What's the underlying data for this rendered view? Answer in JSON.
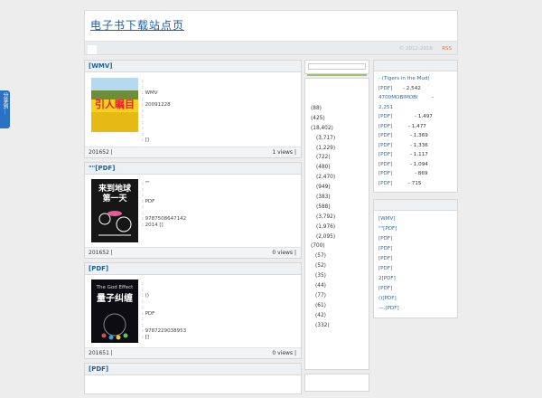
{
  "share": {
    "label": "分享到"
  },
  "header": {
    "title": "电子书下载站点页",
    "copyright": "© 2012-2016",
    "rss": "RSS"
  },
  "posts": [
    {
      "title": "[WMV]",
      "meta": [
        ":",
        ":",
        ": WMV",
        ":",
        ": 20091228",
        ":",
        ":",
        ":",
        ":",
        ":",
        ":          []"
      ],
      "date": "201652 |",
      "views": "1 views |"
    },
    {
      "title": "\"\"[PDF]",
      "meta": [
        ": \"\"",
        ":",
        ":",
        ": PDF",
        ":",
        ":",
        ": 9787508647142",
        ": 2014  []"
      ],
      "date": "201652 |",
      "views": "0 views |"
    },
    {
      "title": "[PDF]",
      "meta": [
        ":",
        ":",
        ": ()",
        ":",
        ":",
        ": PDF",
        ":",
        ":",
        ": 9787229038953",
        ":    []"
      ],
      "date": "201651 |",
      "views": "0 views |"
    },
    {
      "title": "[PDF]"
    }
  ],
  "thumbs": {
    "t1_text": "引人瞩目",
    "t2_l1": "来到地球",
    "t2_l2": "第一天",
    "t3_top": "The God Effect",
    "t3_title": "量子纠缠"
  },
  "categories": [
    {
      "label": "(88)",
      "lvl": 0
    },
    {
      "label": "(425)",
      "lvl": 0
    },
    {
      "label": "(18,402)",
      "lvl": 0
    },
    {
      "label": "(3,717)",
      "lvl": 1
    },
    {
      "label": "(1,229)",
      "lvl": 1
    },
    {
      "label": "(722)",
      "lvl": 1
    },
    {
      "label": "(480)",
      "lvl": 1
    },
    {
      "label": "(2,470)",
      "lvl": 1
    },
    {
      "label": "(949)",
      "lvl": 1
    },
    {
      "label": "(383)",
      "lvl": 1
    },
    {
      "label": "(588)",
      "lvl": 1
    },
    {
      "label": "(3,792)",
      "lvl": 1
    },
    {
      "label": "(1,976)",
      "lvl": 1
    },
    {
      "label": "(2,095)",
      "lvl": 1
    },
    {
      "label": "(700)",
      "lvl": 0
    },
    {
      "label": "(57)",
      "lvl": 2
    },
    {
      "label": "(52)",
      "lvl": 2
    },
    {
      "label": "(35)",
      "lvl": 2
    },
    {
      "label": "(44)",
      "lvl": 2
    },
    {
      "label": "(77)",
      "lvl": 2
    },
    {
      "label": "(61)",
      "lvl": 2
    },
    {
      "label": "(42)",
      "lvl": 2
    },
    {
      "label": "(332)",
      "lvl": 2
    }
  ],
  "popular": [
    {
      "label": "- (Tigers in the Mud)",
      "value": ""
    },
    {
      "label": "[PDF]",
      "value": "- 2,542"
    },
    {
      "label": "4700MOBIMOBI",
      "value": "-"
    },
    {
      "label": "2,251",
      "value": ""
    },
    {
      "label": " [PDF]",
      "value": "- 1,497"
    },
    {
      "label": "[PDF]",
      "value": "- 1,477"
    },
    {
      "label": "[PDF]",
      "value": "- 1,369"
    },
    {
      "label": "[PDF]",
      "value": "- 1,336"
    },
    {
      "label": "[PDF]",
      "value": "- 1,117"
    },
    {
      "label": "[PDF]",
      "value": "- 1,094"
    },
    {
      "label": " [PDF]",
      "value": "- 869"
    },
    {
      "label": "[PDF]",
      "value": "- 715"
    }
  ],
  "recent": [
    "[WMV]",
    "\"\"[PDF]",
    " [PDF]",
    "[PDF]",
    "[PDF]",
    "[PDF]",
    "2[PDF]",
    "[PDF]",
    "()[PDF]",
    "—.[PDF]"
  ],
  "colors": {
    "link": "#2b6aa8",
    "rss": "#e2762a",
    "share": "#2a72c4",
    "accent_green": "#9ec46a"
  }
}
